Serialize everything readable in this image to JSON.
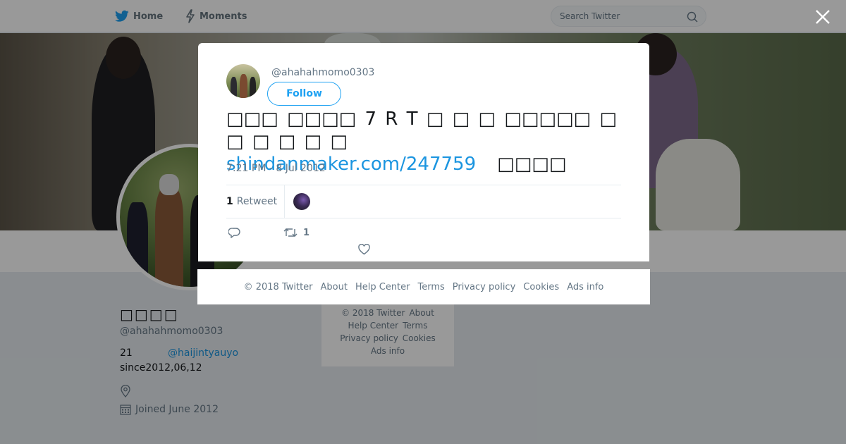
{
  "topbar": {
    "home_label": "Home",
    "moments_label": "Moments",
    "search_placeholder": "Search Twitter"
  },
  "profile": {
    "name": "□□□□",
    "handle": "@ahahahmomo0303",
    "bio_line1_prefix": "21",
    "bio_mention": "@haijintyauyo",
    "bio_line2": "since2012,06,12",
    "joined": "Joined June 2012"
  },
  "background_footer": {
    "items": [
      "© 2018 Twitter",
      "About",
      "Help Center",
      "Terms",
      "Privacy policy",
      "Cookies",
      "Ads info"
    ]
  },
  "tweet": {
    "handle": "@ahahahmomo0303",
    "follow_label": "Follow",
    "text_part1": "□□□ □□□□ 7 R T □ □ □ □□□□□ □ □ □ □ □ □",
    "link": "shindanmaker.com/247759",
    "text_part2": "□□□□",
    "timestamp": "7:21 PM - 8 Jul 2012",
    "retweet_count": "1",
    "retweet_label": "Retweet",
    "action_retweet_count": "1"
  },
  "modal_footer": {
    "items": [
      "© 2018 Twitter",
      "About",
      "Help Center",
      "Terms",
      "Privacy policy",
      "Cookies",
      "Ads info"
    ]
  },
  "colors": {
    "accent": "#1da1f2",
    "link": "#1b95e0",
    "muted": "#657786"
  },
  "icons": [
    "twitter-bird-icon",
    "moments-bolt-icon",
    "search-icon",
    "close-icon",
    "location-pin-icon",
    "calendar-icon",
    "reply-icon",
    "retweet-icon",
    "like-heart-icon"
  ]
}
